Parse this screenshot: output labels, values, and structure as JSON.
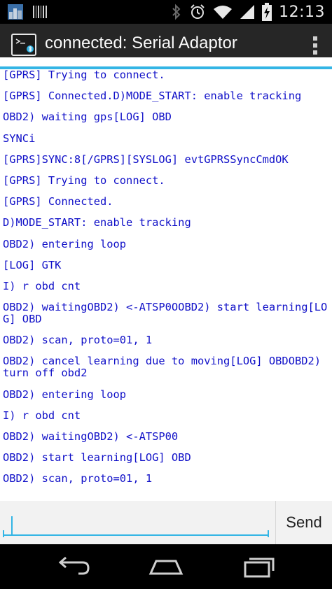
{
  "status_bar": {
    "time": "12:13",
    "icons": [
      "gallery-icon",
      "barcode-icon",
      "bluetooth-icon",
      "alarm-icon",
      "wifi-icon",
      "signal-icon",
      "battery-charging-icon"
    ]
  },
  "action_bar": {
    "icon": "terminal-bluetooth-icon",
    "title": "connected: Serial Adaptor",
    "overflow_icon": "overflow-menu-icon"
  },
  "terminal": {
    "lines": [
      "[GPRS] Trying to connect.",
      "[GPRS] Connected.D)MODE_START: enable tracking",
      "OBD2) waiting gps[LOG] OBD",
      "SYNCi",
      "[GPRS]SYNC:8[/GPRS][SYSLOG] evtGPRSSyncCmdOK",
      "[GPRS] Trying to connect.",
      "[GPRS] Connected.",
      "D)MODE_START: enable tracking",
      "OBD2) entering loop",
      "[LOG] GTK",
      "I) r obd cnt",
      "OBD2) waitingOBD2) <-ATSP0OOBD2) start learning[LOG] OBD",
      "OBD2) scan, proto=01, 1",
      "OBD2) cancel learning due to moving[LOG] OBDOBD2) turn off obd2",
      "OBD2) entering loop",
      "I) r obd cnt",
      "OBD2) waitingOBD2) <-ATSP00",
      "OBD2) start learning[LOG] OBD",
      "OBD2) scan, proto=01, 1"
    ]
  },
  "input": {
    "value": "",
    "placeholder": "",
    "send_label": "Send"
  },
  "nav_bar": {
    "icons": [
      "back-icon",
      "home-icon",
      "recent-apps-icon"
    ]
  },
  "colors": {
    "accent": "#33b5e5",
    "terminal_text": "#1010c8",
    "action_bar": "#262626"
  }
}
